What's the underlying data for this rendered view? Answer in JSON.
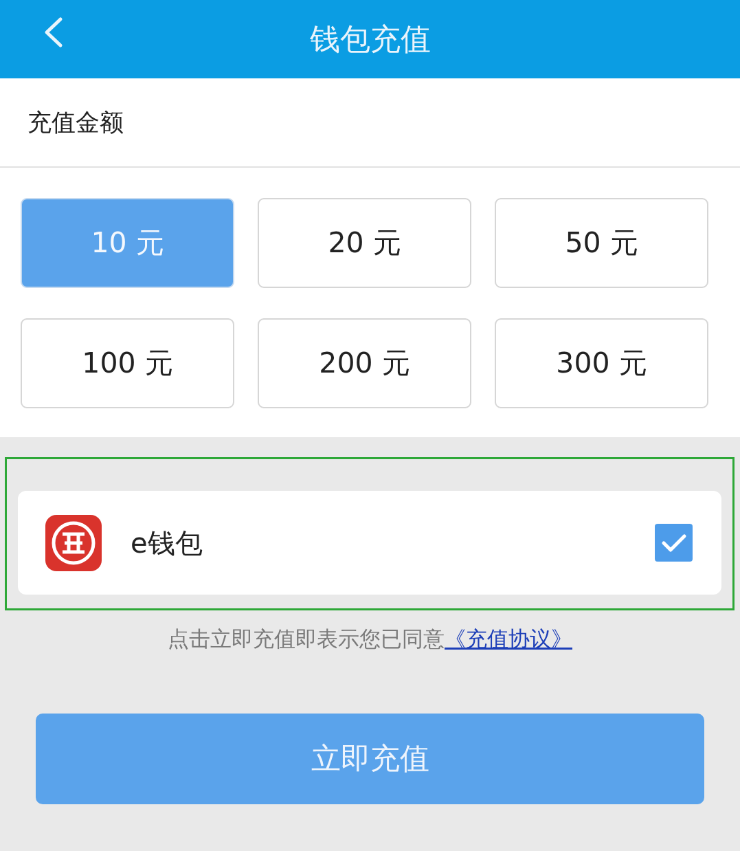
{
  "header": {
    "title": "钱包充值"
  },
  "amount_label": "充值金额",
  "amounts": [
    {
      "label": "10 元",
      "selected": true
    },
    {
      "label": "20 元",
      "selected": false
    },
    {
      "label": "50 元",
      "selected": false
    },
    {
      "label": "100 元",
      "selected": false
    },
    {
      "label": "200 元",
      "selected": false
    },
    {
      "label": "300 元",
      "selected": false
    }
  ],
  "payment_methods": [
    {
      "label": "e钱包",
      "checked": true,
      "highlighted": true
    }
  ],
  "agreement": {
    "text": "点击立即充值即表示您已同意",
    "link": "《充值协议》"
  },
  "submit_button": "立即充值"
}
